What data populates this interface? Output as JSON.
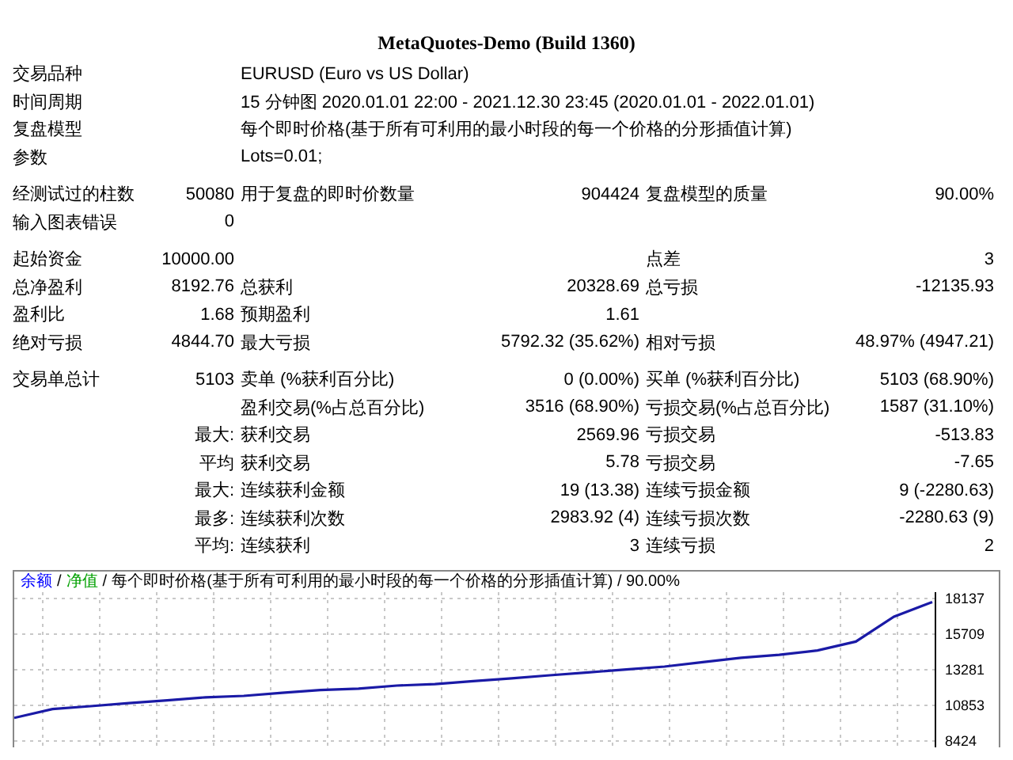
{
  "report": {
    "subtitle": "MetaQuotes-Demo (Build 1360)"
  },
  "info_rows": [
    {
      "label": "交易品种",
      "value": "EURUSD (Euro vs US Dollar)"
    },
    {
      "label": "时间周期",
      "value": "15 分钟图 2020.01.01 22:00 - 2021.12.30 23:45 (2020.01.01 - 2022.01.01)"
    },
    {
      "label": "复盘模型",
      "value": "每个即时价格(基于所有可利用的最小时段的每一个价格的分形插值计算)"
    },
    {
      "label": "参数",
      "value": "Lots=0.01;"
    }
  ],
  "sections": [
    {
      "rows": [
        {
          "left": {
            "label": "经测试过的柱数",
            "value": "50080"
          },
          "middle": {
            "label": "用于复盘的即时价数量",
            "value": "904424"
          },
          "right": {
            "label": "复盘模型的质量",
            "value": "90.00%"
          }
        },
        {
          "left": {
            "label": "输入图表错误",
            "value": "0"
          }
        }
      ]
    },
    {
      "rows": [
        {
          "left": {
            "label": "起始资金",
            "value": "10000.00"
          },
          "right": {
            "label": "点差",
            "value": "3"
          }
        },
        {
          "left": {
            "label": "总净盈利",
            "value": "8192.76"
          },
          "middle": {
            "label": "总获利",
            "value": "20328.69"
          },
          "right": {
            "label": "总亏损",
            "value": "-12135.93"
          }
        },
        {
          "left": {
            "label": "盈利比",
            "value": "1.68"
          },
          "middle": {
            "label": "预期盈利",
            "value": "1.61"
          }
        },
        {
          "left": {
            "label": "绝对亏损",
            "value": "4844.70"
          },
          "middle": {
            "label": "最大亏损",
            "value": "5792.32 (35.62%)"
          },
          "right": {
            "label": "相对亏损",
            "value": "48.97% (4947.21)"
          }
        }
      ]
    },
    {
      "rows": [
        {
          "left": {
            "label": "交易单总计",
            "value": "5103"
          },
          "middle": {
            "label": "卖单 (%获利百分比)",
            "value": "0 (0.00%)"
          },
          "right": {
            "label": "买单 (%获利百分比)",
            "value": "5103 (68.90%)"
          }
        },
        {
          "middle": {
            "label": "盈利交易(%占总百分比)",
            "value": "3516 (68.90%)"
          },
          "right": {
            "label": "亏损交易(%占总百分比)",
            "value": "1587 (31.10%)"
          }
        },
        {
          "left": {
            "value": "最大:"
          },
          "middle": {
            "label": "获利交易",
            "value": "2569.96"
          },
          "right": {
            "label": "亏损交易",
            "value": "-513.83"
          }
        },
        {
          "left": {
            "value": "平均"
          },
          "middle": {
            "label": "获利交易",
            "value": "5.78"
          },
          "right": {
            "label": "亏损交易",
            "value": "-7.65"
          }
        },
        {
          "left": {
            "value": "最大:"
          },
          "middle": {
            "label": "连续获利金额",
            "value": "19 (13.38)"
          },
          "right": {
            "label": "连续亏损金额",
            "value": "9 (-2280.63)"
          }
        },
        {
          "left": {
            "value": "最多:"
          },
          "middle": {
            "label": "连续获利次数",
            "value": "2983.92 (4)"
          },
          "right": {
            "label": "连续亏损次数",
            "value": "-2280.63 (9)"
          }
        },
        {
          "left": {
            "value": "平均:"
          },
          "middle": {
            "label": "连续获利",
            "value": "3"
          },
          "right": {
            "label": "连续亏损",
            "value": "2"
          }
        }
      ]
    }
  ],
  "chart": {
    "legend": [
      {
        "text": "余额",
        "color": "#0000ff"
      },
      {
        "text": "净值",
        "color": "#00a000"
      }
    ],
    "separator": "/",
    "caption": "每个即时价格(基于所有可利用的最小时段的每一个价格的分形插值计算) / 90.00%",
    "chart_data": {
      "type": "line",
      "grid": true,
      "series": [
        {
          "color": "#1a1aa6",
          "values": [
            10000,
            10600,
            10800,
            11000,
            11200,
            11400,
            11500,
            11700,
            11900,
            12000,
            12200,
            12300,
            12500,
            12700,
            12900,
            13100,
            13300,
            13500,
            13800,
            14100,
            14300,
            14600,
            15200,
            16900,
            17900
          ]
        }
      ],
      "ylim": [
        8424,
        18137
      ],
      "yticks": [
        8424,
        10853,
        13281,
        15709,
        18137
      ]
    }
  }
}
